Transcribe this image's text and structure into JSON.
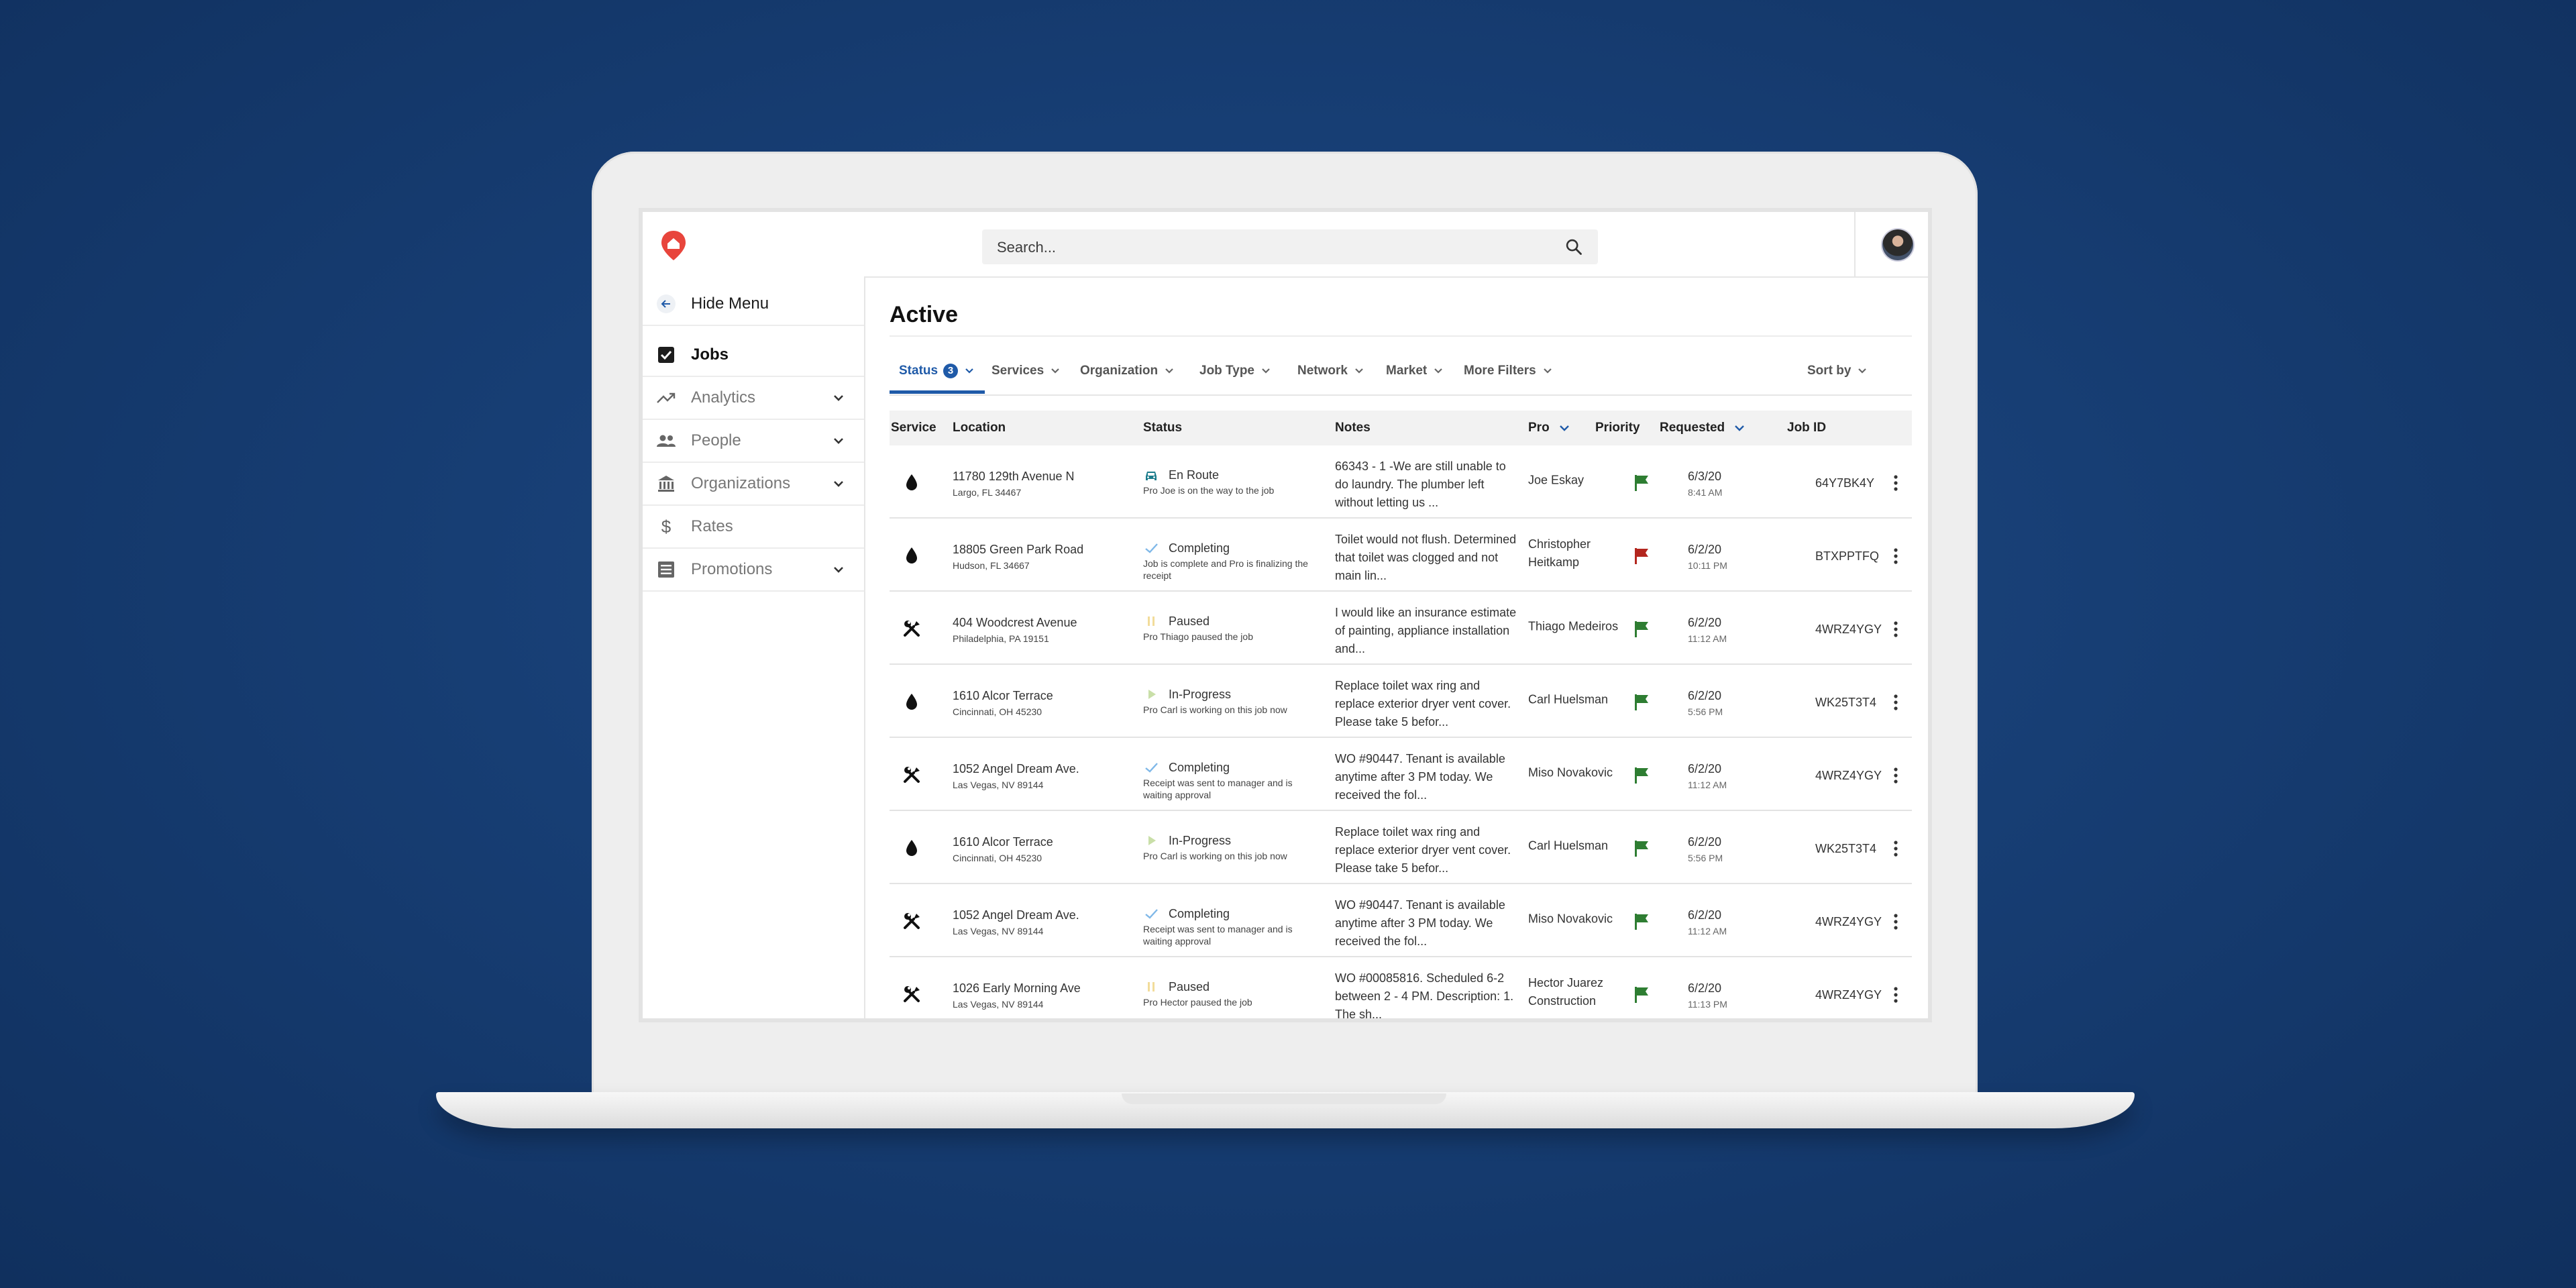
{
  "search": {
    "placeholder": "Search..."
  },
  "sidebar": {
    "hide_menu": "Hide Menu",
    "items": [
      {
        "label": "Jobs",
        "icon": "checkbox-icon",
        "active": true
      },
      {
        "label": "Analytics",
        "icon": "trending-up-icon",
        "expandable": true
      },
      {
        "label": "People",
        "icon": "people-icon",
        "expandable": true
      },
      {
        "label": "Organizations",
        "icon": "bank-icon",
        "expandable": true
      },
      {
        "label": "Rates",
        "icon": "dollar-icon"
      },
      {
        "label": "Promotions",
        "icon": "list-icon",
        "expandable": true
      }
    ]
  },
  "main": {
    "title": "Active",
    "filters": [
      {
        "label": "Status",
        "badge": "3"
      },
      {
        "label": "Services"
      },
      {
        "label": "Organization"
      },
      {
        "label": "Job Type"
      },
      {
        "label": "Network"
      },
      {
        "label": "Market"
      },
      {
        "label": "More Filters"
      }
    ],
    "sort_by": "Sort by"
  },
  "table": {
    "columns": [
      "Service",
      "Location",
      "Status",
      "Notes",
      "Pro",
      "Priority",
      "Requested",
      "Job ID"
    ],
    "rows": [
      {
        "service": "water-drop-icon",
        "address": "11780 129th Avenue N",
        "city": "Largo, FL 34467",
        "status": "En Route",
        "status_icon": "car-icon",
        "status_detail": "Pro Joe is on the way to the job",
        "notes": "66343 - 1 -We are still unable to do laundry. The plumber left without letting us ...",
        "pro": "Joe Eskay",
        "priority": "green",
        "date": "6/3/20",
        "time": "8:41 AM",
        "job_id": "64Y7BK4Y"
      },
      {
        "service": "water-drop-icon",
        "address": "18805 Green Park Road",
        "city": "Hudson, FL 34667",
        "status": "Completing",
        "status_icon": "check-icon",
        "status_detail": "Job is complete and Pro is finalizing the receipt",
        "notes": "Toilet would not flush. Determined that toilet was clogged and not main lin...",
        "pro": "Christopher Heitkamp",
        "priority": "red",
        "date": "6/2/20",
        "time": "10:11 PM",
        "job_id": "BTXPPTFQ"
      },
      {
        "service": "tools-icon",
        "address": "404 Woodcrest Avenue",
        "city": "Philadelphia, PA 19151",
        "status": "Paused",
        "status_icon": "pause-icon",
        "status_detail": "Pro Thiago paused the job",
        "notes": "I would like an insurance estimate of painting, appliance installation and...",
        "pro": "Thiago Medeiros",
        "priority": "green",
        "date": "6/2/20",
        "time": "11:12 AM",
        "job_id": "4WRZ4YGY"
      },
      {
        "service": "water-drop-icon",
        "address": "1610 Alcor Terrace",
        "city": "Cincinnati, OH 45230",
        "status": "In-Progress",
        "status_icon": "play-icon",
        "status_detail": "Pro Carl is working on this job now",
        "notes": "Replace toilet wax ring and replace exterior dryer vent cover. Please take 5 befor...",
        "pro": "Carl Huelsman",
        "priority": "green",
        "date": "6/2/20",
        "time": "5:56 PM",
        "job_id": "WK25T3T4"
      },
      {
        "service": "tools-icon",
        "address": "1052 Angel Dream Ave.",
        "city": "Las Vegas, NV 89144",
        "status": "Completing",
        "status_icon": "check-icon",
        "status_detail": "Receipt was sent to manager and is waiting approval",
        "notes": "WO #90447. Tenant is available anytime after 3 PM today. We received the fol...",
        "pro": "Miso Novakovic",
        "priority": "green",
        "date": "6/2/20",
        "time": "11:12 AM",
        "job_id": "4WRZ4YGY"
      },
      {
        "service": "water-drop-icon",
        "address": "1610 Alcor Terrace",
        "city": "Cincinnati, OH 45230",
        "status": "In-Progress",
        "status_icon": "play-icon",
        "status_detail": "Pro Carl is working on this job now",
        "notes": "Replace toilet wax ring and replace exterior dryer vent cover. Please take 5 befor...",
        "pro": "Carl Huelsman",
        "priority": "green",
        "date": "6/2/20",
        "time": "5:56 PM",
        "job_id": "WK25T3T4"
      },
      {
        "service": "tools-icon",
        "address": "1052 Angel Dream Ave.",
        "city": "Las Vegas, NV 89144",
        "status": "Completing",
        "status_icon": "check-icon",
        "status_detail": "Receipt was sent to manager and is waiting approval",
        "notes": "WO #90447. Tenant is available anytime after 3 PM today. We received the fol...",
        "pro": "Miso Novakovic",
        "priority": "green",
        "date": "6/2/20",
        "time": "11:12 AM",
        "job_id": "4WRZ4YGY"
      },
      {
        "service": "tools-icon",
        "address": "1026 Early Morning Ave",
        "city": "Las Vegas, NV 89144",
        "status": "Paused",
        "status_icon": "pause-icon",
        "status_detail": "Pro Hector paused the job",
        "notes": "WO #00085816. Scheduled 6-2 between 2 - 4 PM. Description: 1. The sh...",
        "pro": "Hector Juarez Construction",
        "priority": "green",
        "date": "6/2/20",
        "time": "11:13 PM",
        "job_id": "4WRZ4YGY"
      }
    ]
  },
  "colors": {
    "accent": "#1f5aa8",
    "brand": "#e8453c",
    "flag_green": "#2e7d32",
    "flag_red": "#b3261e",
    "background": "#173e74"
  }
}
